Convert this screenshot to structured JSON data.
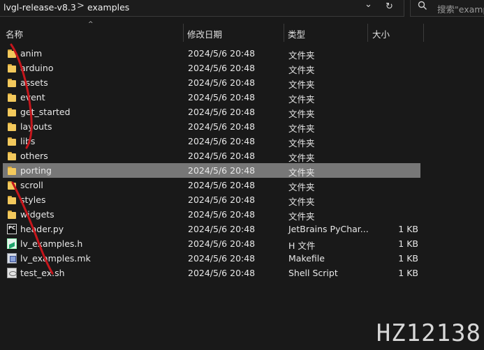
{
  "addressbar": {
    "crumbs": [
      "lvgl-release-v8.3",
      "examples"
    ],
    "separator": ">",
    "dropdown_glyph": "⌄",
    "refresh_glyph": "↻"
  },
  "search": {
    "placeholder": "搜索\"examp",
    "icon": "search-icon"
  },
  "columns": {
    "name": "名称",
    "modified": "修改日期",
    "type": "类型",
    "size": "大小"
  },
  "files": [
    {
      "name": "anim",
      "modified": "2024/5/6 20:48",
      "type": "文件夹",
      "size": "",
      "icon": "folder-icon"
    },
    {
      "name": "arduino",
      "modified": "2024/5/6 20:48",
      "type": "文件夹",
      "size": "",
      "icon": "folder-icon"
    },
    {
      "name": "assets",
      "modified": "2024/5/6 20:48",
      "type": "文件夹",
      "size": "",
      "icon": "folder-icon"
    },
    {
      "name": "event",
      "modified": "2024/5/6 20:48",
      "type": "文件夹",
      "size": "",
      "icon": "folder-icon"
    },
    {
      "name": "get_started",
      "modified": "2024/5/6 20:48",
      "type": "文件夹",
      "size": "",
      "icon": "folder-icon"
    },
    {
      "name": "layouts",
      "modified": "2024/5/6 20:48",
      "type": "文件夹",
      "size": "",
      "icon": "folder-icon"
    },
    {
      "name": "libs",
      "modified": "2024/5/6 20:48",
      "type": "文件夹",
      "size": "",
      "icon": "folder-icon"
    },
    {
      "name": "others",
      "modified": "2024/5/6 20:48",
      "type": "文件夹",
      "size": "",
      "icon": "folder-icon"
    },
    {
      "name": "porting",
      "modified": "2024/5/6 20:48",
      "type": "文件夹",
      "size": "",
      "icon": "folder-icon",
      "selected": true
    },
    {
      "name": "scroll",
      "modified": "2024/5/6 20:48",
      "type": "文件夹",
      "size": "",
      "icon": "folder-icon"
    },
    {
      "name": "styles",
      "modified": "2024/5/6 20:48",
      "type": "文件夹",
      "size": "",
      "icon": "folder-icon"
    },
    {
      "name": "widgets",
      "modified": "2024/5/6 20:48",
      "type": "文件夹",
      "size": "",
      "icon": "folder-icon"
    },
    {
      "name": "header.py",
      "modified": "2024/5/6 20:48",
      "type": "JetBrains PyChar...",
      "size": "1 KB",
      "icon": "pycharm-file-icon"
    },
    {
      "name": "lv_examples.h",
      "modified": "2024/5/6 20:48",
      "type": "H 文件",
      "size": "1 KB",
      "icon": "header-file-icon"
    },
    {
      "name": "lv_examples.mk",
      "modified": "2024/5/6 20:48",
      "type": "Makefile",
      "size": "1 KB",
      "icon": "makefile-icon"
    },
    {
      "name": "test_ex.sh",
      "modified": "2024/5/6 20:48",
      "type": "Shell Script",
      "size": "1 KB",
      "icon": "shell-script-icon"
    }
  ],
  "watermark": "HZ12138",
  "colors": {
    "background": "#191919",
    "selection": "#777777",
    "folder": "#f3c95c",
    "annotation": "#c4161c"
  }
}
